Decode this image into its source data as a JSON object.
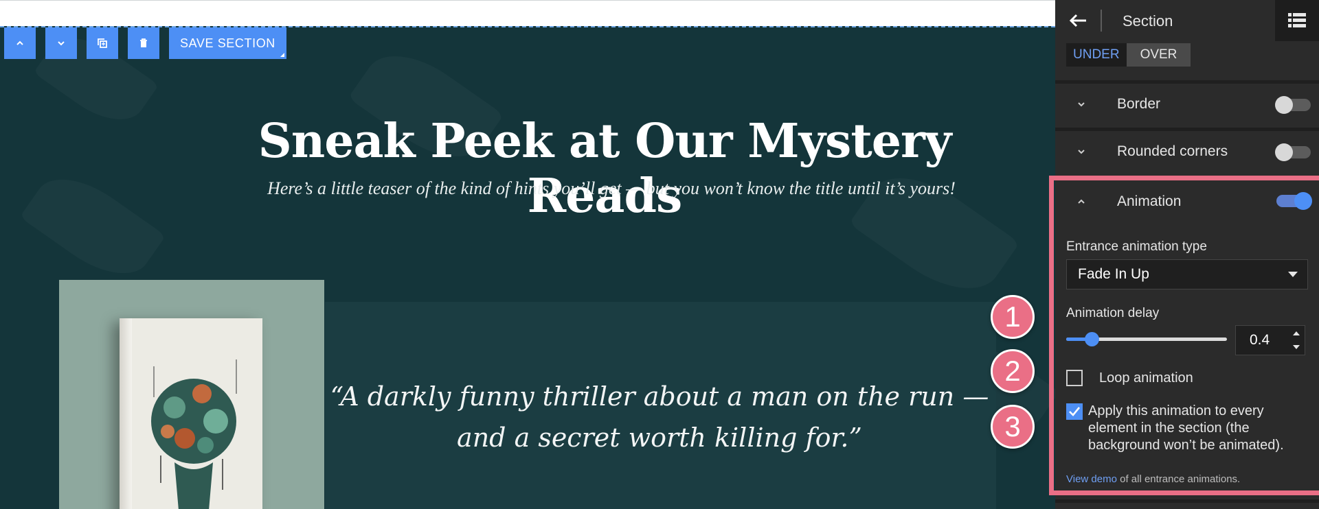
{
  "canvas": {
    "toolbar": {
      "save_label": "SAVE SECTION"
    },
    "headline": "Sneak Peek at Our Mystery Reads",
    "subheadline": "Here’s a little teaser of the kind of hints you’ll get — but you won’t know the title until it’s yours!",
    "quote": "“A darkly funny thriller about a man on the run — and a secret worth killing for.”",
    "markers": [
      "1",
      "2",
      "3"
    ]
  },
  "sidebar": {
    "title": "Section",
    "segment": {
      "under": "UNDER",
      "over": "OVER",
      "active": "UNDER"
    },
    "border": {
      "label": "Border",
      "enabled": false
    },
    "rounded": {
      "label": "Rounded corners",
      "enabled": false
    },
    "animation": {
      "label": "Animation",
      "enabled": true,
      "type_label": "Entrance animation type",
      "type_value": "Fade In Up",
      "delay_label": "Animation delay",
      "delay_value": "0.4",
      "delay_slider_fraction": 0.16,
      "loop_label": "Loop animation",
      "loop_checked": false,
      "apply_all_label": "Apply this animation to every element in the section (the background won’t be animated).",
      "apply_all_checked": true,
      "demo_link": "View demo",
      "demo_rest": "of all entrance animations."
    }
  },
  "colors": {
    "accent": "#4d8ff5",
    "highlight": "#ea6f86",
    "section_bg": "#14353a",
    "sidebar_bg": "#2b2b2b"
  }
}
